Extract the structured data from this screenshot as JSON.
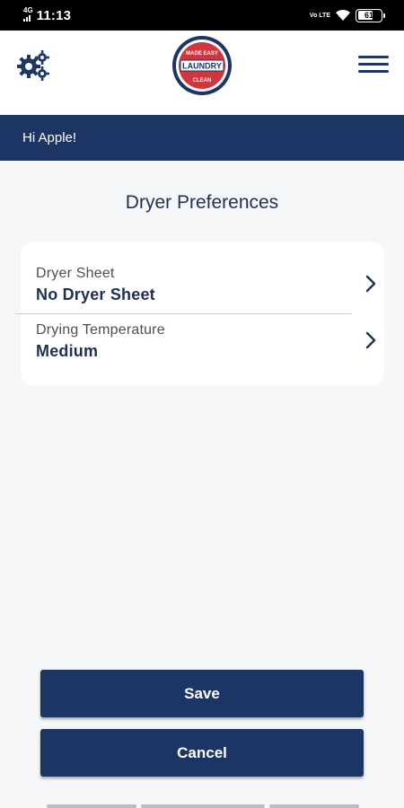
{
  "status_bar": {
    "network": "4G",
    "time": "11:13",
    "volte": "Vo LTE",
    "battery": "61"
  },
  "header": {
    "logo_text": "LAUNDRY",
    "logo_arc_top": "MADE EASY",
    "logo_arc_bottom": "CLEAN"
  },
  "greeting": "Hi Apple!",
  "page_title": "Dryer Preferences",
  "preferences": [
    {
      "label": "Dryer Sheet",
      "value": "No Dryer Sheet"
    },
    {
      "label": "Drying Temperature",
      "value": "Medium"
    }
  ],
  "buttons": {
    "save": "Save",
    "cancel": "Cancel"
  },
  "colors": {
    "primary": "#1c3565",
    "background": "#f6f7f9",
    "logo_red": "#d2353d"
  },
  "icons": {
    "settings": "gears-icon",
    "menu": "hamburger-menu-icon",
    "row_arrow": "chevron-right-icon"
  }
}
